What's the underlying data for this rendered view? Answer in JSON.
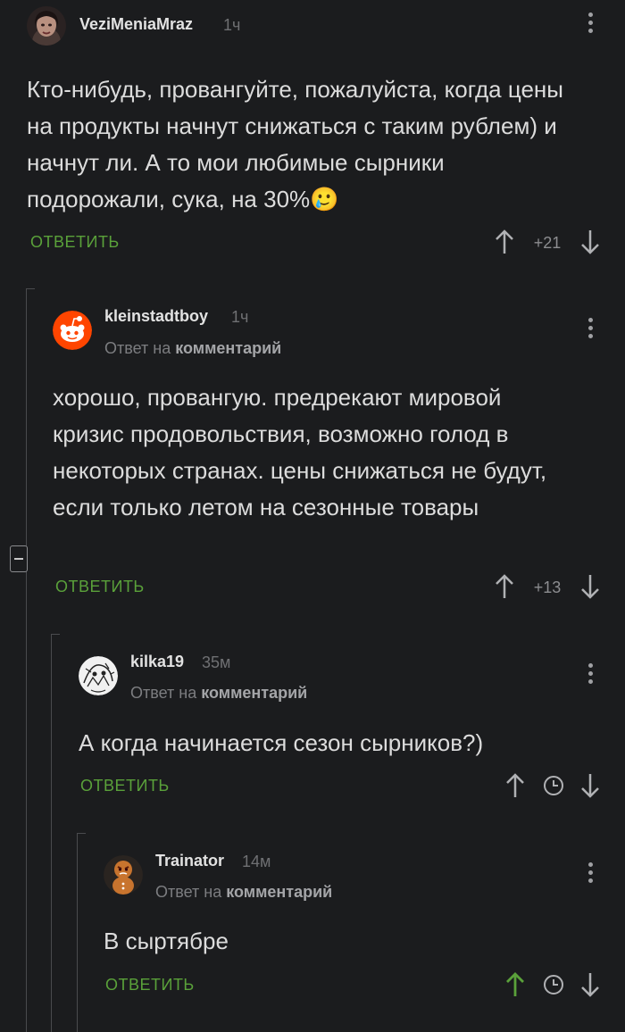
{
  "colors": {
    "background": "#1b1c1e",
    "reply_green": "#5aa13a",
    "upvoted_green": "#5aa13a",
    "muted": "#7c7d80"
  },
  "comments": [
    {
      "username": "VeziMeniaMraz",
      "time": "1ч",
      "reply_to": null,
      "text": "Кто-нибудь, провангуйте, пожалуйста, когда цены на продукты начнут снижаться с таким рублем) и начнут ли. А то мои любимые сырники подорожали, сука, на 30%🥲",
      "reply_label": "ОТВЕТИТЬ",
      "score": "+21",
      "avatar_icon": "user-photo-avatar"
    },
    {
      "username": "kleinstadtboy",
      "time": "1ч",
      "reply_to_prefix": "Ответ на",
      "reply_to_target": "комментарий",
      "text": "хорошо, провангую. предрекают мировой кризис продовольствия, возможно голод в некоторых странах. цены снижаться не будут, если только летом на сезонные товары",
      "reply_label": "ОТВЕТИТЬ",
      "score": "+13",
      "avatar_icon": "reddit-alien-avatar"
    },
    {
      "username": "kilka19",
      "time": "35м",
      "reply_to_prefix": "Ответ на",
      "reply_to_target": "комментарий",
      "text": "А когда начинается сезон сырников?)",
      "reply_label": "ОТВЕТИТЬ",
      "score": null,
      "avatar_icon": "sketch-drawing-avatar"
    },
    {
      "username": "Trainator",
      "time": "14м",
      "reply_to_prefix": "Ответ на",
      "reply_to_target": "комментарий",
      "text": "В сыртябре",
      "reply_label": "ОТВЕТИТЬ",
      "score": null,
      "avatar_icon": "gingerbread-avatar"
    }
  ]
}
